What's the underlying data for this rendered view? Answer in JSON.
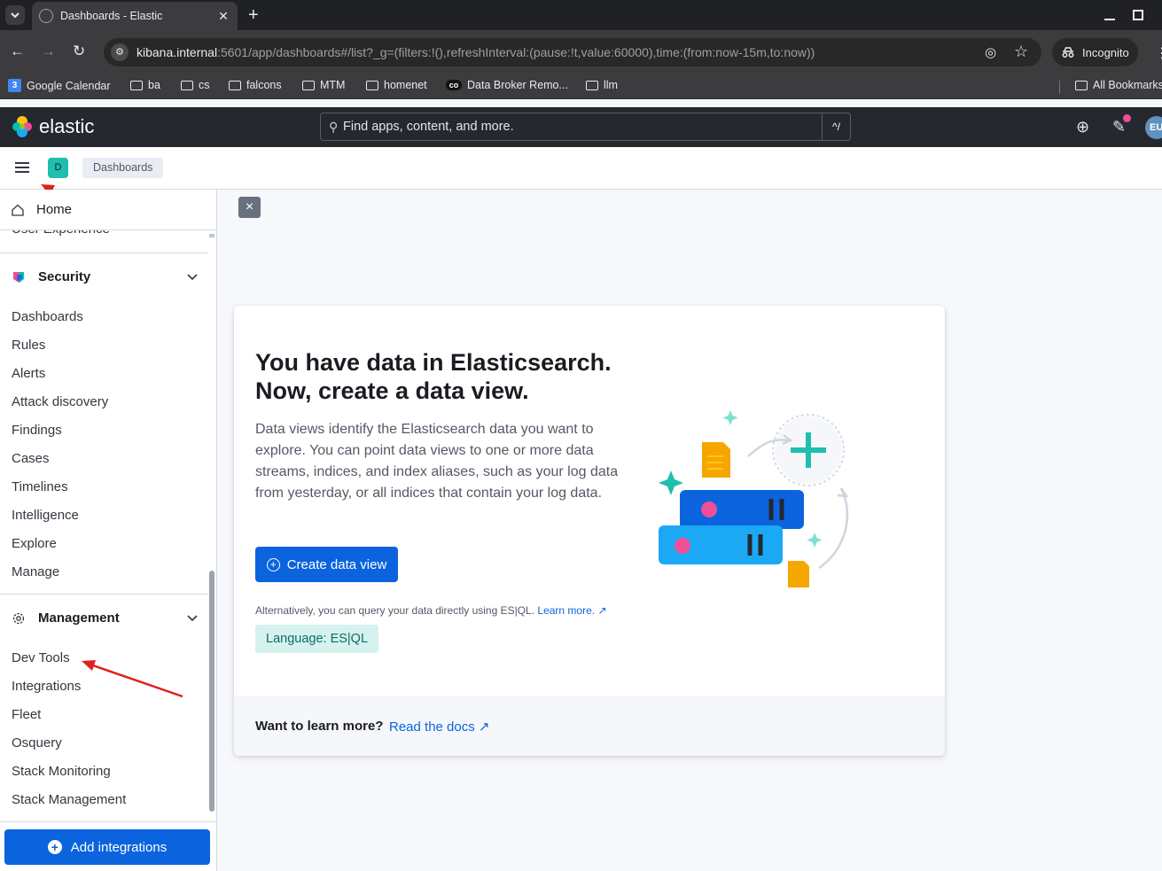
{
  "browser": {
    "tab_title": "Dashboards - Elastic",
    "url_host": "kibana.internal",
    "url_rest": ":5601/app/dashboards#/list?_g=(filters:!(),refreshInterval:(pause:!t,value:60000),time:(from:now-15m,to:now))",
    "incognito_label": "Incognito",
    "bookmarks": [
      "Google Calendar",
      "ba",
      "cs",
      "falcons",
      "MTM",
      "homenet",
      "Data Broker Remo...",
      "llm",
      "All Bookmarks"
    ]
  },
  "kibana_header": {
    "logo_text": "elastic",
    "search_placeholder": "Find apps, content, and more.",
    "search_shortcut": "^/",
    "avatar_initials": "EU"
  },
  "subbar": {
    "space_initial": "D",
    "breadcrumb": "Dashboards"
  },
  "sidenav": {
    "home_label": "Home",
    "partial_item": "User Experience",
    "security": {
      "label": "Security",
      "items": [
        "Dashboards",
        "Rules",
        "Alerts",
        "Attack discovery",
        "Findings",
        "Cases",
        "Timelines",
        "Intelligence",
        "Explore",
        "Manage"
      ]
    },
    "management": {
      "label": "Management",
      "items": [
        "Dev Tools",
        "Integrations",
        "Fleet",
        "Osquery",
        "Stack Monitoring",
        "Stack Management"
      ]
    },
    "add_integrations_label": "Add integrations"
  },
  "main": {
    "dismiss_label": "×",
    "title_line1": "You have data in Elasticsearch.",
    "title_line2": "Now, create a data view.",
    "description": "Data views identify the Elasticsearch data you want to explore. You can point data views to one or more data streams, indices, and index aliases, such as your log data from yesterday, or all indices that contain your log data.",
    "create_button": "Create data view",
    "alt_text": "Alternatively, you can query your data directly using ES|QL.",
    "alt_link": "Learn more.",
    "language_badge": "Language: ES|QL",
    "footer_question": "Want to learn more?",
    "footer_link": "Read the docs"
  },
  "colors": {
    "primary": "#0b64dd",
    "header_bg": "#25282f",
    "accent_teal": "#1ebfae",
    "annotation_arrow": "#e0201b"
  }
}
